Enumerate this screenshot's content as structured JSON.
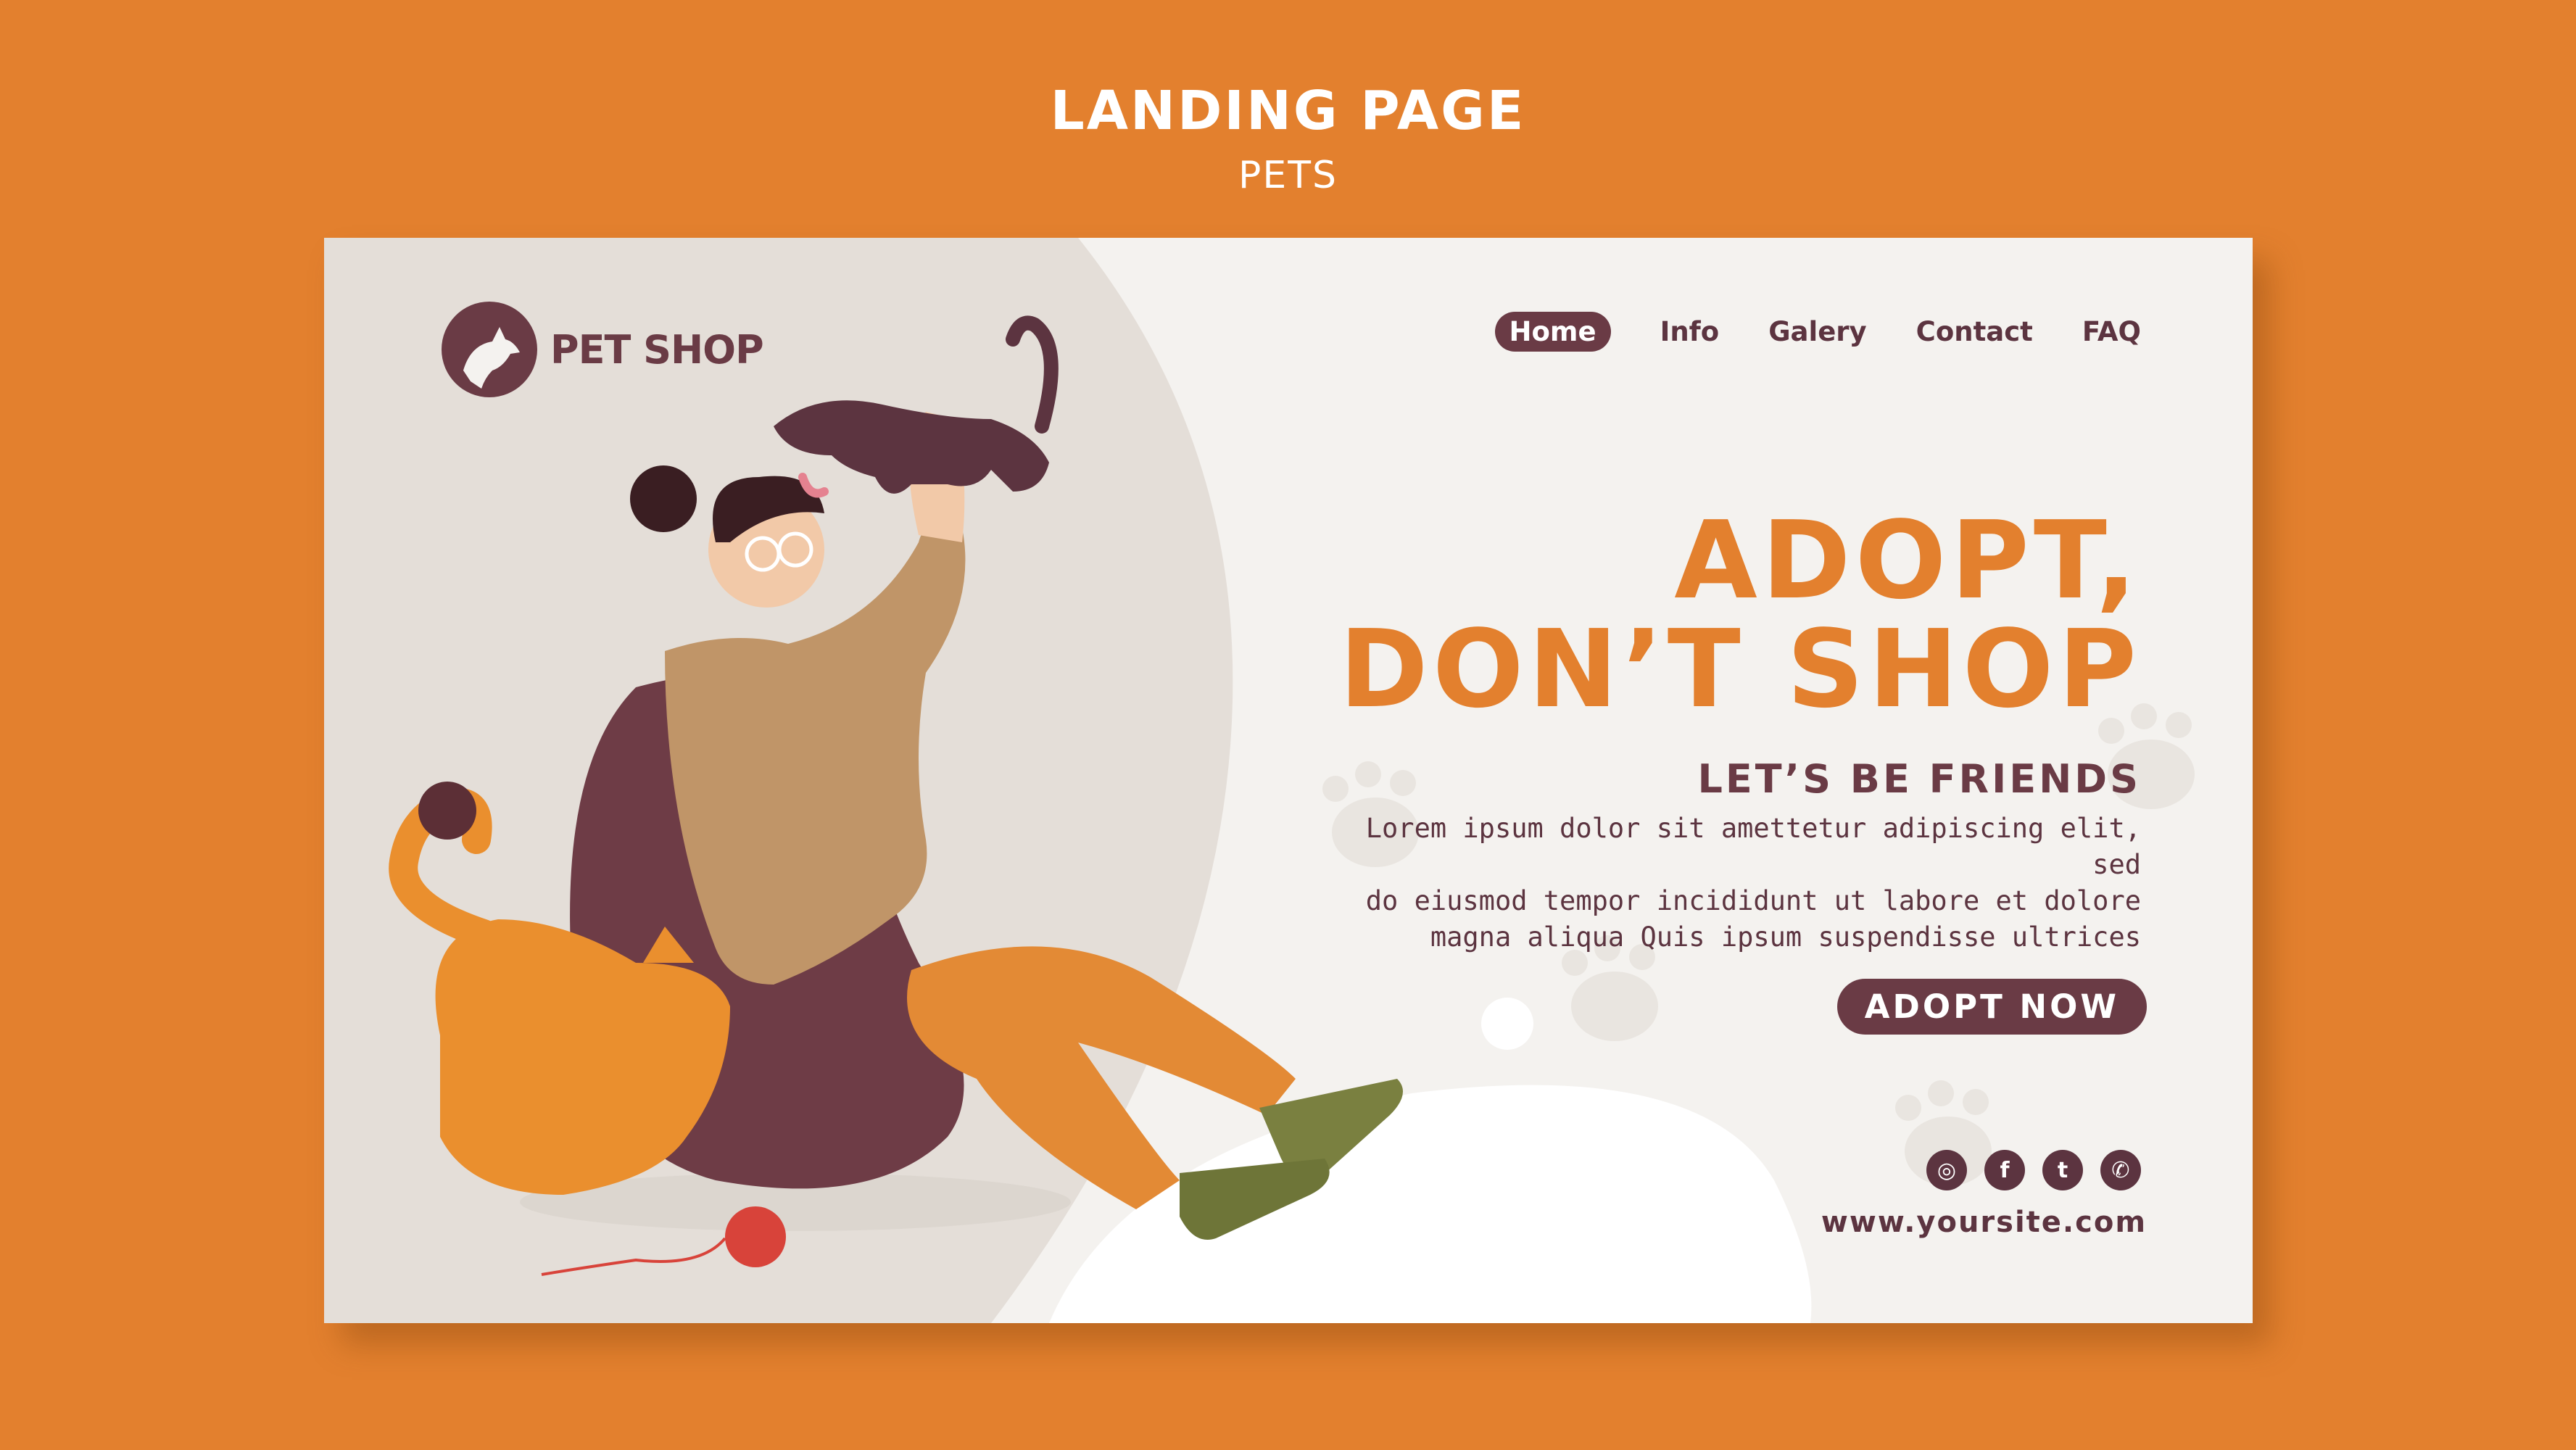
{
  "header": {
    "title": "LANDING PAGE",
    "subtitle": "PETS"
  },
  "brand": {
    "name": "PET SHOP",
    "color": "#6A3B45",
    "accent": "#E3802E"
  },
  "nav": {
    "items": [
      "Home",
      "Info",
      "Galery",
      "Contact",
      "FAQ"
    ],
    "active": "Home"
  },
  "hero": {
    "headline_line1": "ADOPT,",
    "headline_line2": "DON’T SHOP",
    "subheading": "LET’S BE FRIENDS",
    "paragraph_line1": "Lorem ipsum dolor sit amettetur adipiscing elit, sed",
    "paragraph_line2": "do eiusmod tempor incididunt ut labore et dolore",
    "paragraph_line3": "magna aliqua Quis ipsum suspendisse ultrices",
    "cta_label": "ADOPT NOW"
  },
  "socials": {
    "icons": [
      "instagram-icon",
      "facebook-icon",
      "twitter-icon",
      "whatsapp-icon"
    ],
    "glyphs": [
      "◎",
      "f",
      "t",
      "✆"
    ]
  },
  "footer": {
    "website": "www.yoursite.com"
  }
}
